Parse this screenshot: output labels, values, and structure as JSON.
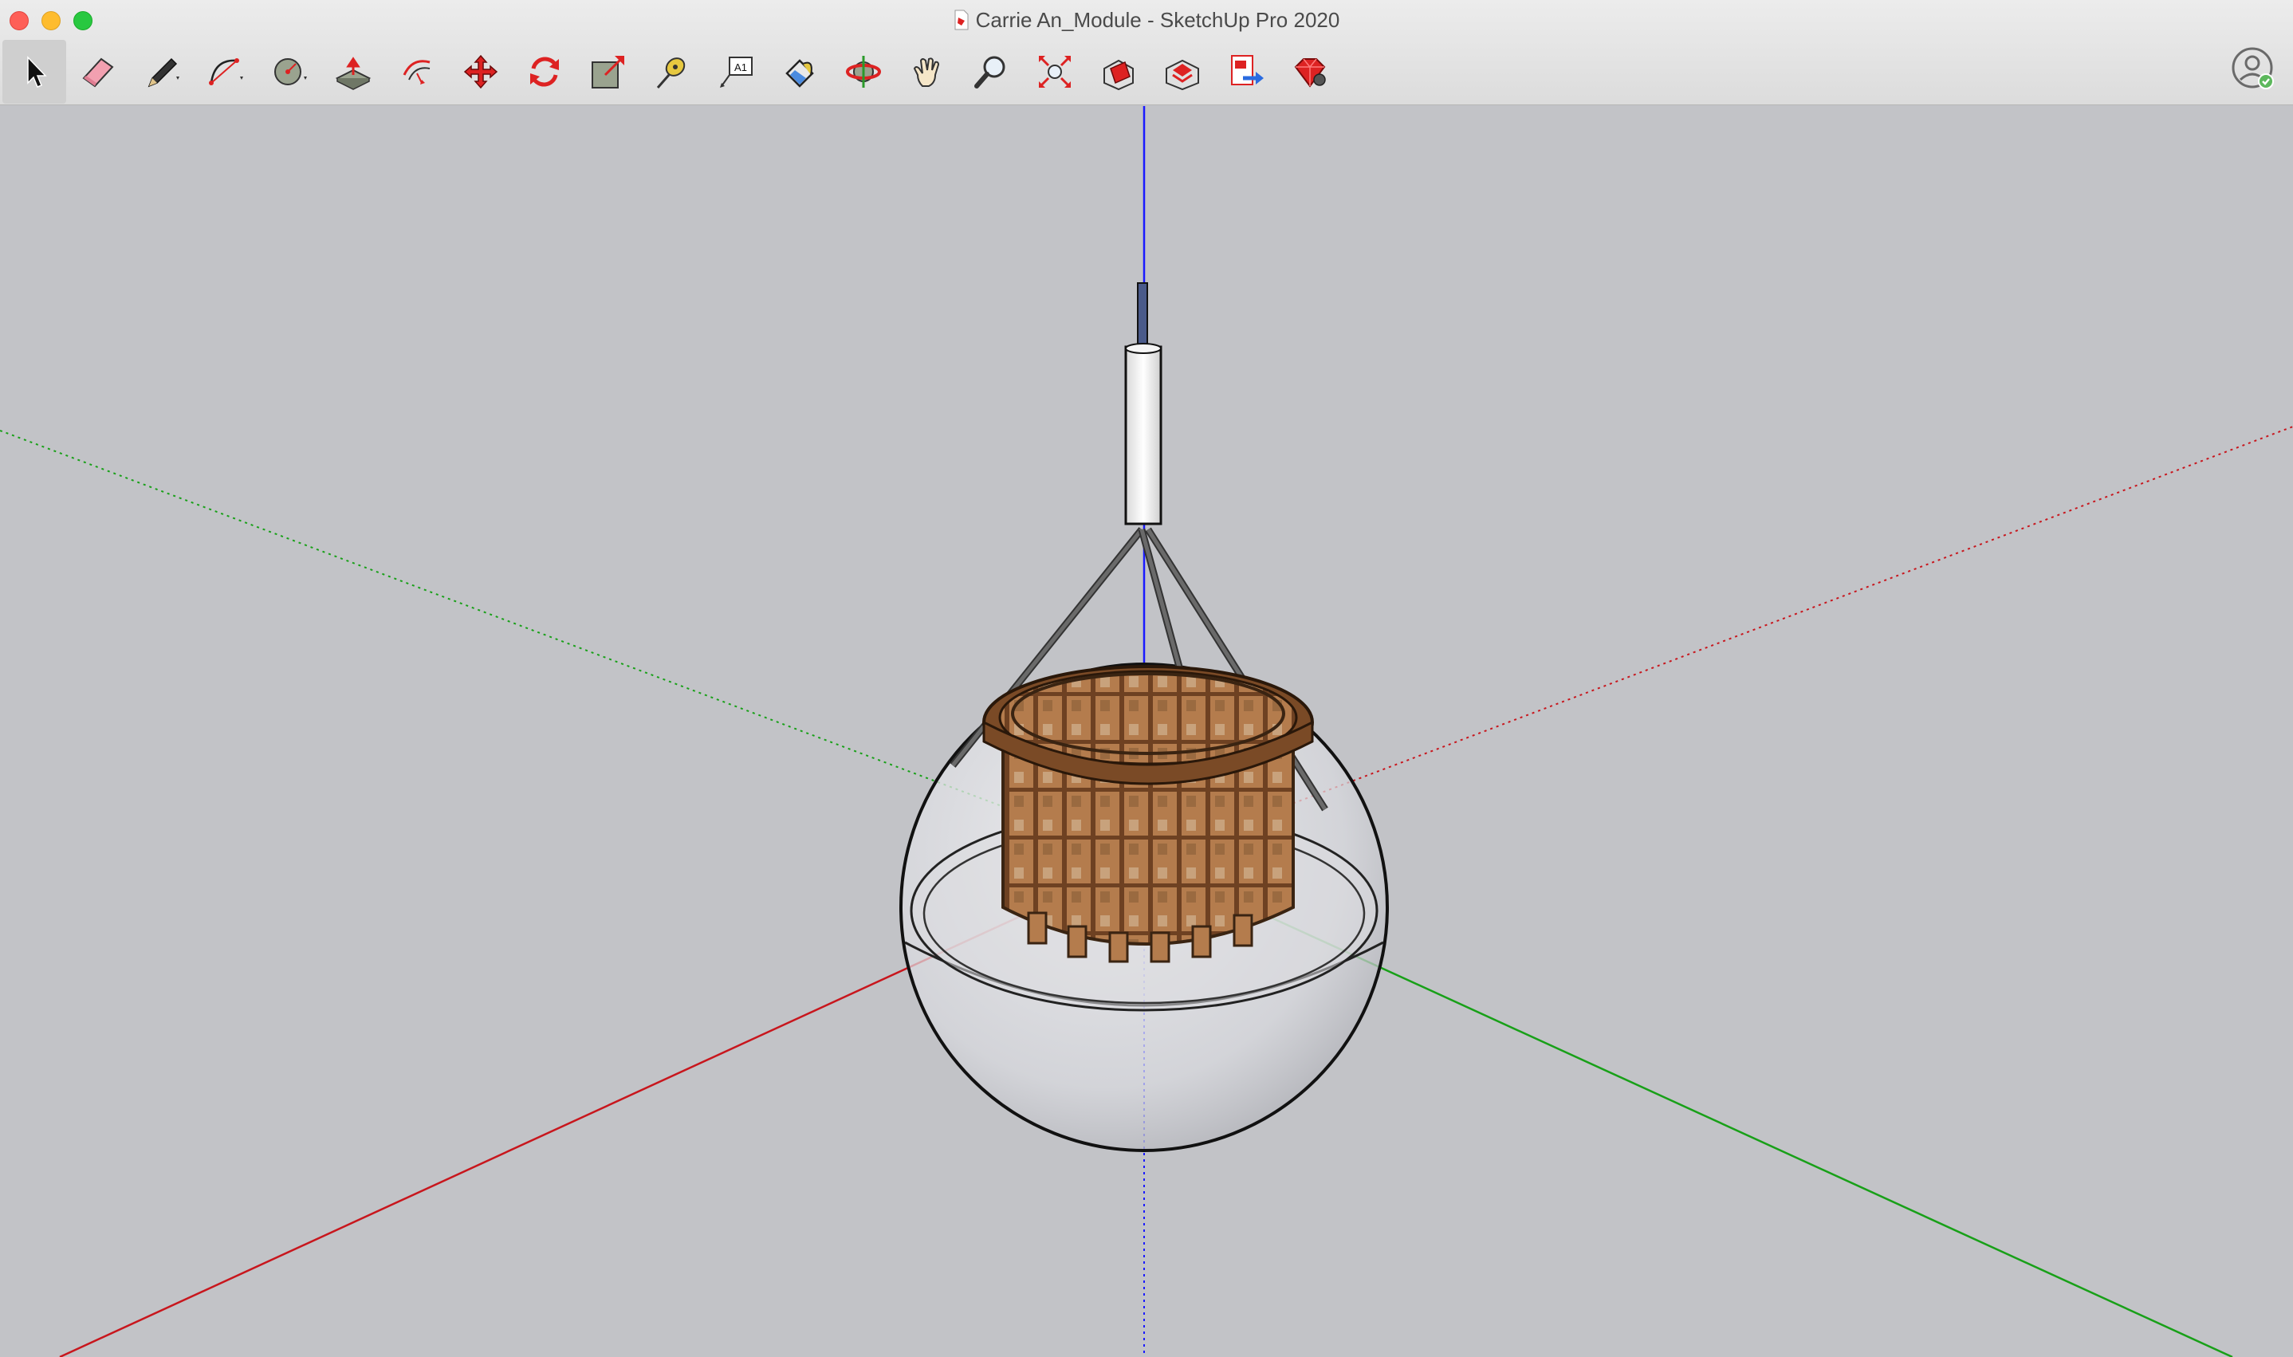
{
  "window": {
    "title": "Carrie An_Module - SketchUp Pro 2020"
  },
  "toolbar": {
    "tools": [
      {
        "name": "select-tool",
        "icon": "arrow-cursor-icon"
      },
      {
        "name": "eraser-tool",
        "icon": "eraser-icon"
      },
      {
        "name": "line-tool",
        "icon": "pencil-icon"
      },
      {
        "name": "arc-tool",
        "icon": "arc-icon"
      },
      {
        "name": "shapes-tool",
        "icon": "circle-shapes-icon"
      },
      {
        "name": "push-pull-tool",
        "icon": "push-pull-icon"
      },
      {
        "name": "offset-tool",
        "icon": "offset-icon"
      },
      {
        "name": "move-tool",
        "icon": "move-arrows-icon"
      },
      {
        "name": "rotate-tool",
        "icon": "rotate-icon"
      },
      {
        "name": "scale-tool",
        "icon": "scale-icon"
      },
      {
        "name": "tape-measure-tool",
        "icon": "tape-measure-icon"
      },
      {
        "name": "text-tool",
        "icon": "text-label-icon"
      },
      {
        "name": "paint-bucket-tool",
        "icon": "paint-bucket-icon"
      },
      {
        "name": "orbit-tool",
        "icon": "orbit-icon"
      },
      {
        "name": "pan-tool",
        "icon": "hand-icon"
      },
      {
        "name": "zoom-tool",
        "icon": "magnifier-icon"
      },
      {
        "name": "zoom-extents-tool",
        "icon": "zoom-extents-icon"
      },
      {
        "name": "3d-warehouse-button",
        "icon": "warehouse-icon"
      },
      {
        "name": "extension-warehouse-button",
        "icon": "extension-warehouse-icon"
      },
      {
        "name": "send-to-layout-button",
        "icon": "layout-icon"
      },
      {
        "name": "extension-manager-button",
        "icon": "ruby-gem-icon"
      }
    ],
    "text_tool_label": "A1"
  },
  "colors": {
    "background": "#c2c3c7",
    "axis_red": "#c8161d",
    "axis_green": "#18a018",
    "axis_blue": "#1a1aff",
    "wood": "#b07a4e",
    "wood_dark": "#7a4a26"
  }
}
